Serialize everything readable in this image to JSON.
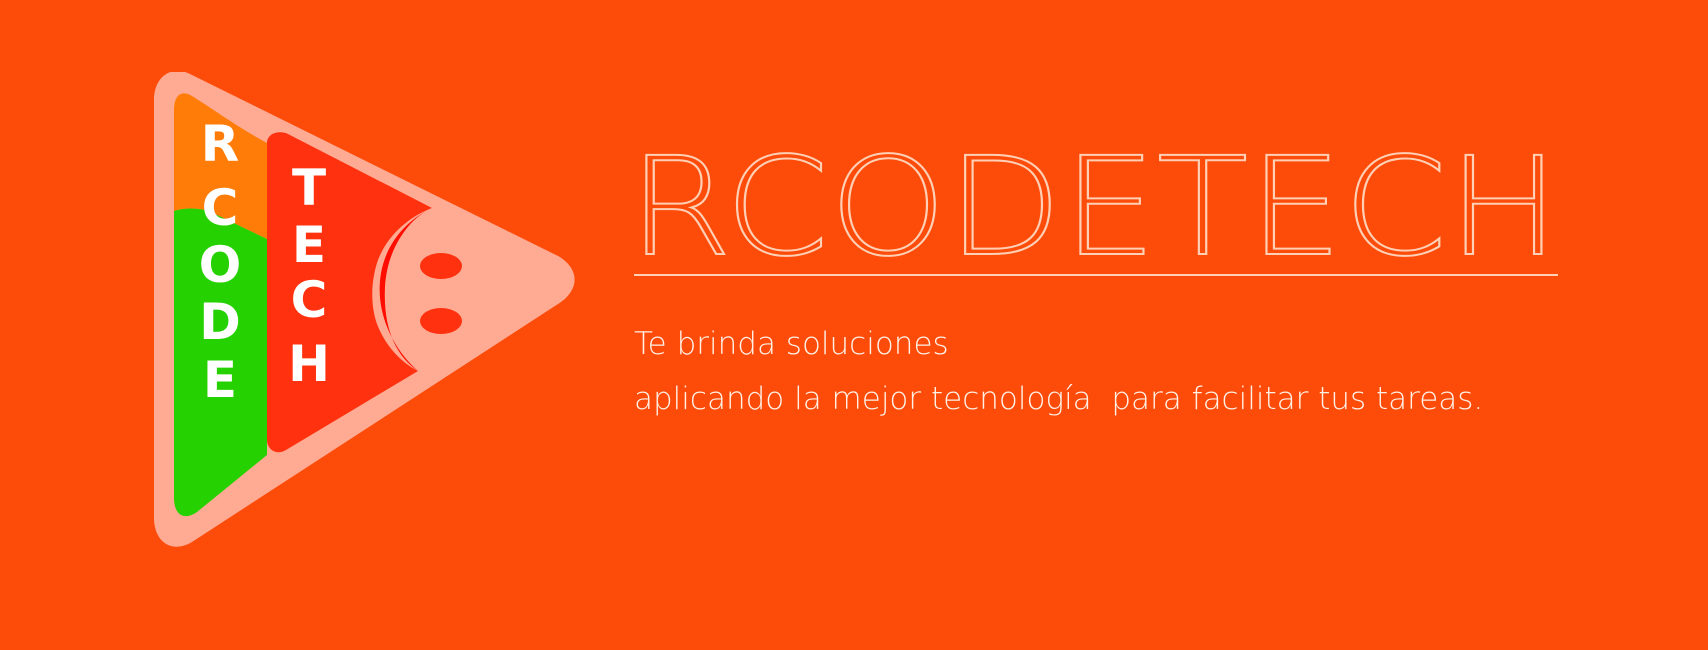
{
  "brand": {
    "logo_letters_left": [
      "R",
      "C",
      "O",
      "D",
      "E"
    ],
    "logo_letters_right": [
      "T",
      "E",
      "C",
      "H"
    ],
    "title": "RCODETECH"
  },
  "tagline": {
    "line1": "Te brinda soluciones",
    "line2": "aplicando la mejor tecnología  para facilitar tus tareas."
  },
  "colors": {
    "background": "#fd4b09",
    "triangle_outer": "#ffab94",
    "triangle_panel_orange": "#ff7c08",
    "triangle_panel_green": "#25d100",
    "triangle_panel_red": "#ff310f",
    "triangle_face_shadow": "#ff0d00",
    "logo_text": "#ffffff",
    "title_line": "#ffd0b5"
  }
}
